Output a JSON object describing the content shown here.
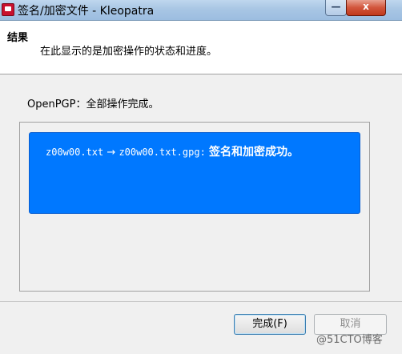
{
  "window": {
    "title": "签名/加密文件 - Kleopatra",
    "minimize_glyph": "—",
    "close_glyph": "x"
  },
  "header": {
    "title": "结果",
    "subtitle": "在此显示的是加密操作的状态和进度。"
  },
  "status": {
    "text": "OpenPGP：全部操作完成。"
  },
  "result": {
    "source_file": "z00w00.txt",
    "arrow": "→",
    "target_file": "z00w00.txt.gpg:",
    "message": "签名和加密成功。",
    "box_color": "#0078ff"
  },
  "buttons": {
    "finish_label": "完成(F)",
    "cancel_label": "取消"
  },
  "watermark": "@51CTO博客"
}
